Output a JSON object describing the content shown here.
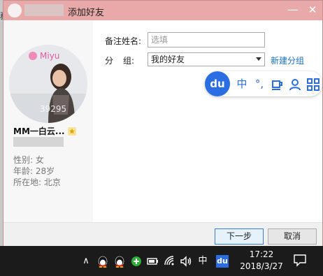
{
  "window": {
    "title": "添加好友",
    "minimize_glyph": "—",
    "close_glyph": "✕"
  },
  "desktop": {
    "edge_glyph": "務"
  },
  "profile": {
    "nickname": "MM一白云...",
    "badge_icon": "star-icon",
    "gender_label": "性别: 女",
    "age_label": "年龄: 28岁",
    "location_label": "所在地:  北京",
    "avatar_watermark": "39295",
    "avatar_text": "Miyu"
  },
  "form": {
    "remark_label": "备注姓名:",
    "remark_placeholder": "选填",
    "group_label_1": "分",
    "group_label_2": "组:",
    "group_value": "我的好友",
    "new_group_link": "新建分组"
  },
  "ime": {
    "logo": "du",
    "mode": "中",
    "punct": "°,",
    "items": [
      "cup-icon",
      "user-icon",
      "grid-icon"
    ]
  },
  "buttons": {
    "next": "下一步",
    "cancel": "取消"
  },
  "taskbar": {
    "chevron": "∧",
    "ime_mode": "中",
    "ime_app": "du",
    "time": "17:22",
    "date": "2018/3/27"
  },
  "colors": {
    "titlebar": "#e9a9a9",
    "link": "#1a6fc4",
    "ime_blue": "#2b6de2",
    "taskbar": "#1b1b1b"
  }
}
